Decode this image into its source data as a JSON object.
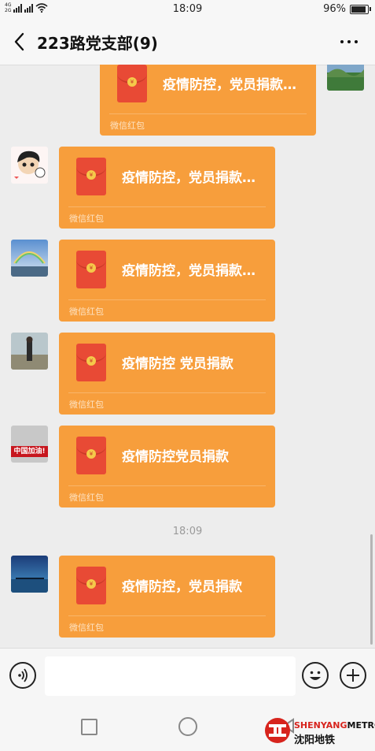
{
  "status_bar": {
    "net1": "4G",
    "net2": "2G",
    "time": "18:09",
    "battery": "96%"
  },
  "header": {
    "title": "223路党支部(9)",
    "back_icon": "chevron-left-icon",
    "more_icon": "ellipsis-icon"
  },
  "messages": [
    {
      "side": "right",
      "text": "疫情防控，党员捐款…",
      "footer": "微信红包"
    },
    {
      "side": "left",
      "text": "疫情防控，党员捐款…",
      "footer": "微信红包"
    },
    {
      "side": "left",
      "text": "疫情防控，党员捐款…",
      "footer": "微信红包"
    },
    {
      "side": "left",
      "text": "疫情防控  党员捐款",
      "footer": "微信红包"
    },
    {
      "side": "left",
      "text": "疫情防控党员捐款",
      "footer": "微信红包",
      "avatar_caption": "中国加油!"
    },
    {
      "side": "left",
      "text": "疫情防控，党员捐款",
      "footer": "微信红包"
    }
  ],
  "timestamp": "18:09",
  "input_bar": {
    "voice_icon": "voice-icon",
    "emoji_icon": "emoji-icon",
    "plus_icon": "plus-icon",
    "value": ""
  },
  "watermark": {
    "en_left": "SHENYANG",
    "en_right": "METRO",
    "cn": "沈阳地铁"
  },
  "colors": {
    "bubble": "#f79e3c",
    "packet": "#e84a35",
    "background": "#ededed"
  }
}
